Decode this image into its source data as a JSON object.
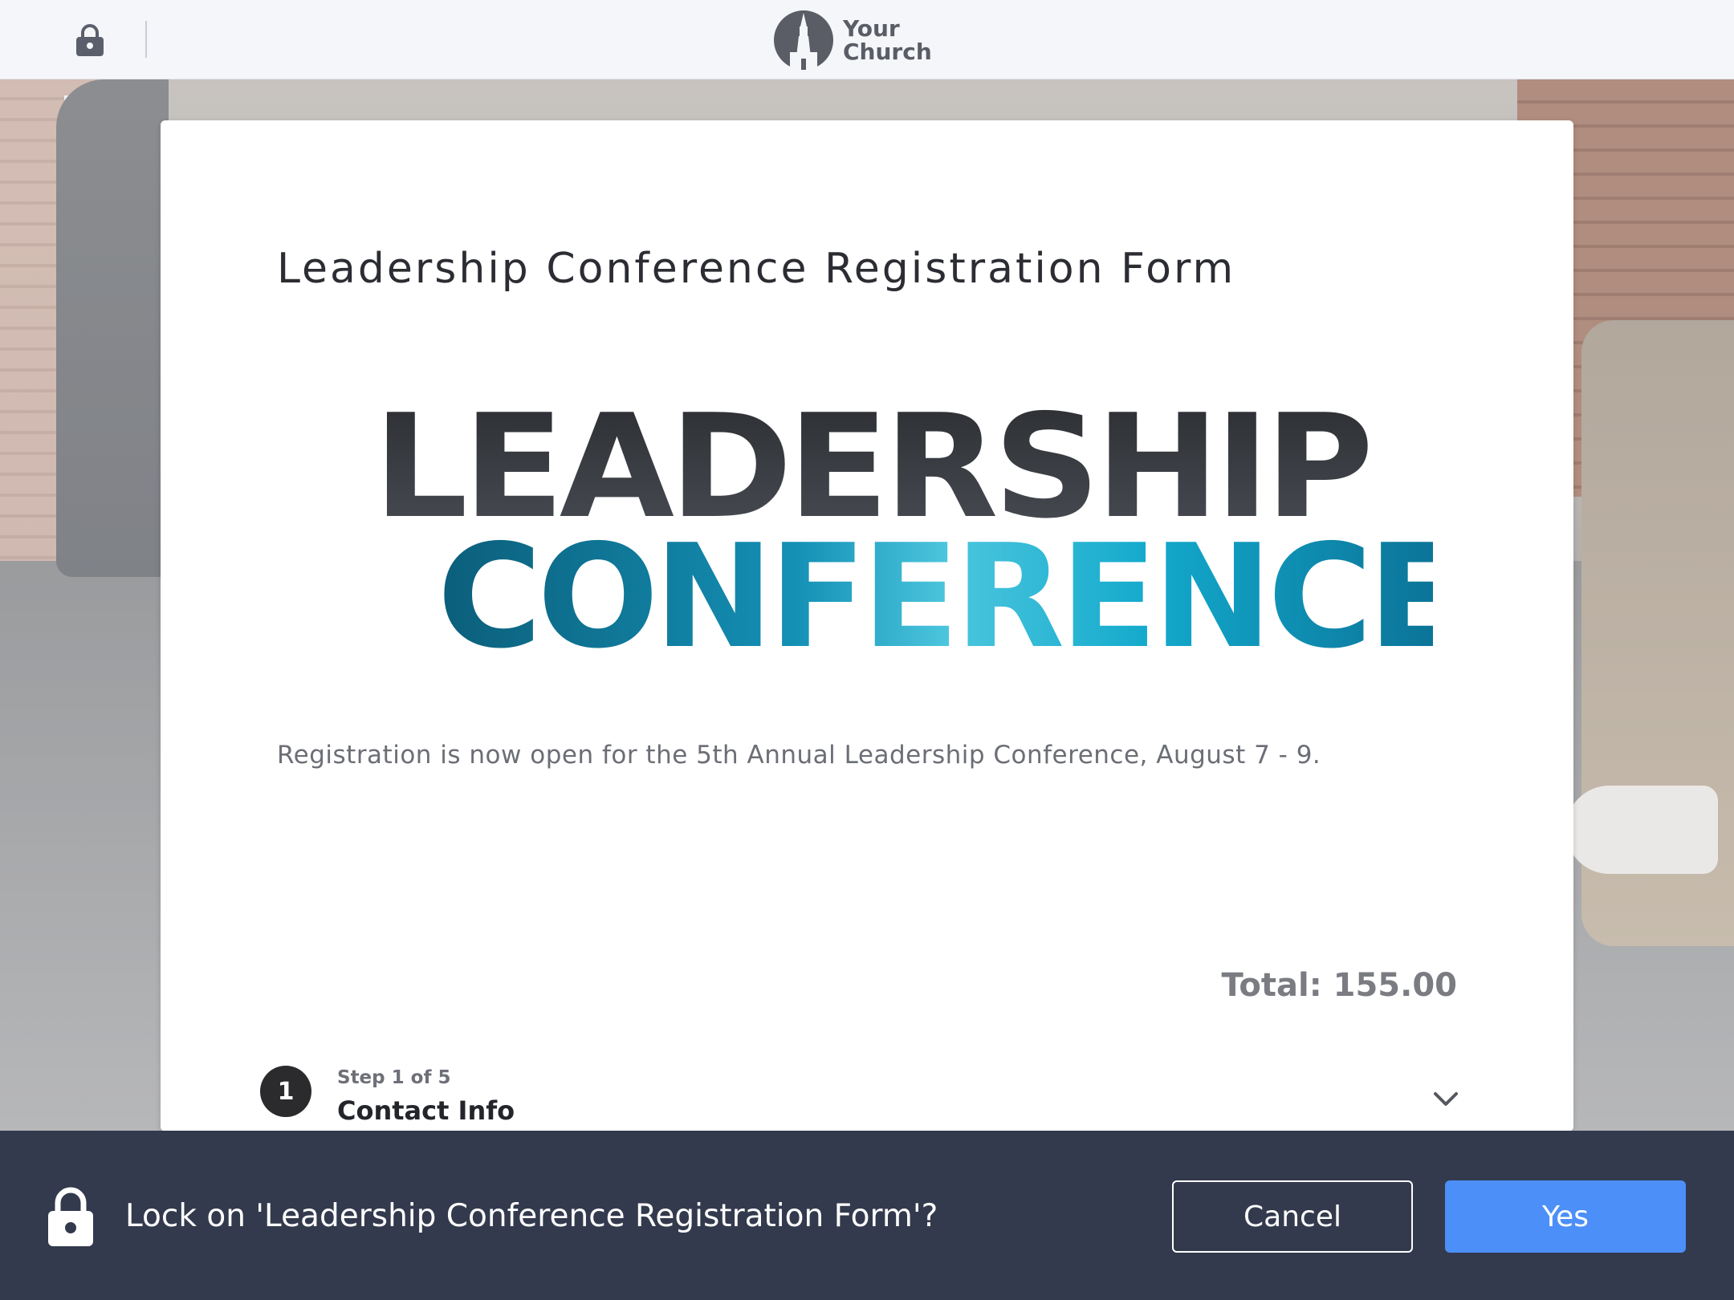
{
  "topbar": {
    "logo_line1": "Your",
    "logo_line2": "Church",
    "lock_icon": "lock-icon"
  },
  "card": {
    "form_title": "Leadership Conference Registration Form",
    "banner": {
      "line1": "LEADERSHIP",
      "line2": "CONFERENCE"
    },
    "description": "Registration is now open for the 5th Annual Leadership Conference, August 7 - 9.",
    "total": "Total: 155.00",
    "step": {
      "number": "1",
      "label": "Step 1 of 5",
      "title": "Contact Info"
    }
  },
  "action_bar": {
    "prompt": "Lock on 'Leadership Conference Registration Form'?",
    "cancel_label": "Cancel",
    "yes_label": "Yes"
  },
  "colors": {
    "accent": "#4d8ff8",
    "action_bar_bg": "#333a4d",
    "banner_dark": "#2f3236",
    "banner_teal": "#1aa3c8"
  }
}
